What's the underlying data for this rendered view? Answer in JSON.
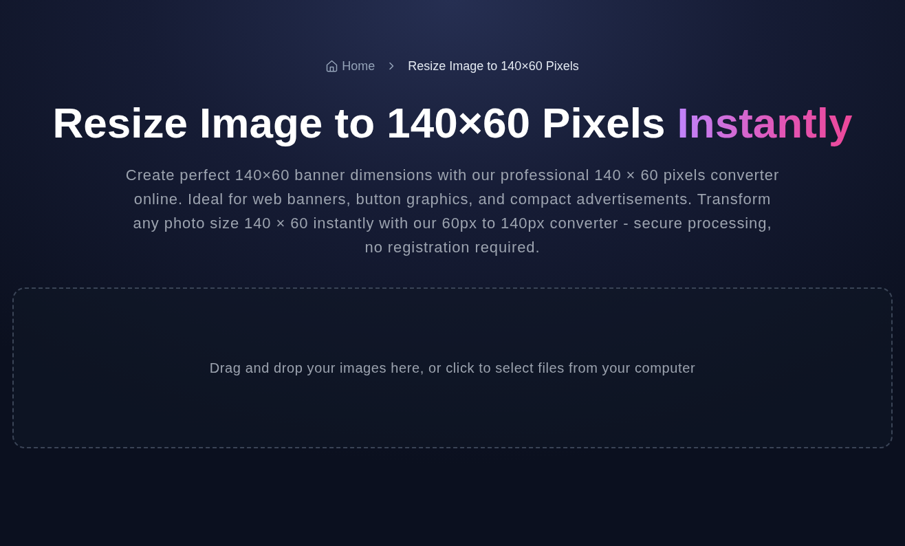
{
  "breadcrumb": {
    "items": [
      {
        "label": "Home",
        "kind": "link"
      },
      {
        "label": "Resize Image to 140×60 Pixels",
        "kind": "current"
      }
    ]
  },
  "hero": {
    "title": "Resize Image to 140×60 Pixels",
    "title_highlight": "Instantly",
    "description": "Create perfect 140×60 banner dimensions with our professional 140 × 60 pixels converter online. Ideal for web banners, button graphics, and compact advertisements. Transform any photo size 140 × 60 instantly with our 60px to 140px converter - secure processing, no registration required."
  },
  "dropzone": {
    "hint": "Drag and drop your images here, or click to select files from your computer"
  }
}
